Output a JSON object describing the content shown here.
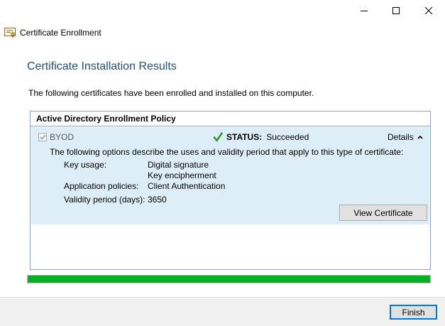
{
  "window": {
    "title": "Certificate Enrollment",
    "controls": {
      "minimize_icon": "minimize-icon",
      "maximize_icon": "maximize-icon",
      "close_icon": "close-icon"
    }
  },
  "page": {
    "heading": "Certificate Installation Results",
    "intro": "The following certificates have been enrolled and installed on this computer."
  },
  "policy": {
    "name": "Active Directory Enrollment Policy",
    "certificate": {
      "name": "BYOD",
      "checked": true,
      "status_label": "STATUS:",
      "status_value": "Succeeded",
      "details_label": "Details",
      "description": "The following options describe the uses and validity period that apply to this type of certificate:",
      "properties": [
        {
          "label": "Key usage:",
          "values": [
            "Digital signature",
            "Key encipherment"
          ]
        },
        {
          "label": "Application policies:",
          "values": [
            "Client Authentication"
          ]
        },
        {
          "label": "Validity period (days):",
          "values": [
            "3650"
          ]
        }
      ],
      "view_button": "View Certificate"
    }
  },
  "progress": {
    "percent": 100,
    "color": "#06b025"
  },
  "footer": {
    "finish_button": "Finish"
  },
  "colors": {
    "heading": "#1f4e79",
    "panel_background": "#deeef8",
    "success_check": "#2e9a2e",
    "accent_border": "#0078d7"
  }
}
